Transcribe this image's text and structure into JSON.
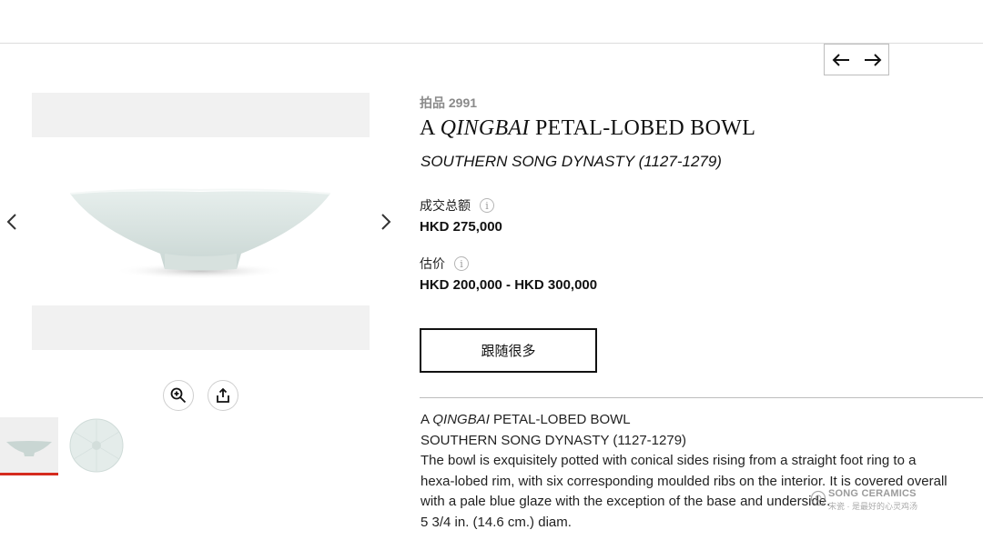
{
  "nav": {
    "prev_icon": "arrow-left-icon",
    "next_icon": "arrow-right-icon"
  },
  "gallery": {
    "prev_icon": "chevron-left-icon",
    "next_icon": "chevron-right-icon",
    "zoom_icon": "zoom-in-icon",
    "share_icon": "share-icon",
    "active_thumb_color": "#d52b1e"
  },
  "lot": {
    "number": "拍品 2991",
    "title_prefix": "A ",
    "title_italic": "QINGBAI",
    "title_suffix": " PETAL-LOBED BOWL",
    "subtitle": "SOUTHERN SONG DYNASTY (1127-1279)",
    "sold_label": "成交总额",
    "sold_value": "HKD 275,000",
    "estimate_label": "估价",
    "estimate_value": "HKD 200,000 - HKD 300,000",
    "info_glyph": "i",
    "follow_label": "跟随很多"
  },
  "description": {
    "title_prefix": "A ",
    "title_italic": "QINGBAI",
    "title_suffix": " PETAL-LOBED BOWL",
    "period": "SOUTHERN SONG DYNASTY (1127-1279)",
    "line1": "The bowl is exquisitely potted with conical sides rising from a straight foot ring to a",
    "line2": "hexa-lobed rim, with six corresponding moulded ribs on the interior. It is covered overall",
    "line3": "with a pale blue glaze with the exception of the base and underside.",
    "dimensions": "5 3/4 in. (14.6 cm.) diam."
  },
  "watermark": {
    "title": "SONG CERAMICS",
    "subtitle": "宋瓷 · 是最好的心灵鸡汤"
  }
}
